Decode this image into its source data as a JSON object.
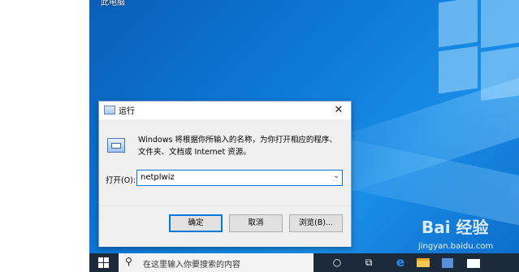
{
  "desktop": {
    "icon_label": "此电脑"
  },
  "run_dialog": {
    "title": "运行",
    "close_glyph": "✕",
    "description": "Windows 将根据你所输入的名称，为你打开相应的程序、文件夹、文档或 Internet 资源。",
    "open_label": "打开(O):",
    "command_value": "netplwiz",
    "dropdown_glyph": "⌄",
    "ok_label": "确定",
    "cancel_label": "取消",
    "browse_label": "浏览(B)..."
  },
  "taskbar": {
    "search_glyph": "⚲",
    "search_placeholder": "在这里输入你要搜索的内容",
    "cortana_glyph": "○",
    "taskview_glyph": "⧉",
    "edge_glyph": "e"
  },
  "watermark": {
    "logo_text": "Bai 经验",
    "url": "jingyan.baidu.com"
  }
}
